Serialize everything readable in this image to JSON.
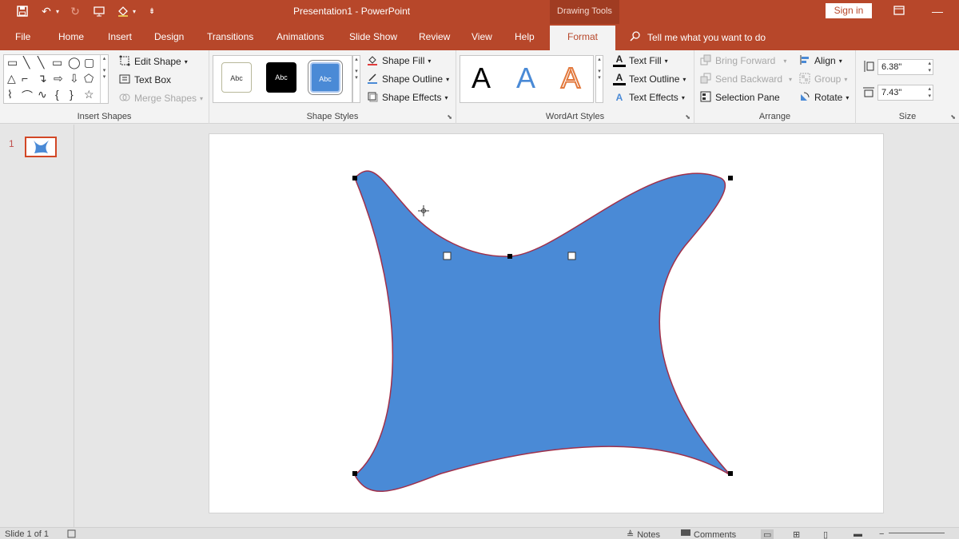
{
  "titlebar": {
    "title": "Presentation1  -  PowerPoint",
    "context_tab": "Drawing Tools",
    "signin": "Sign in",
    "qat": [
      "save-icon",
      "undo-icon",
      "redo-icon",
      "present-icon",
      "paint-icon",
      "customize-icon"
    ]
  },
  "tabs": [
    {
      "label": "File"
    },
    {
      "label": "Home"
    },
    {
      "label": "Insert"
    },
    {
      "label": "Design"
    },
    {
      "label": "Transitions"
    },
    {
      "label": "Animations"
    },
    {
      "label": "Slide Show"
    },
    {
      "label": "Review"
    },
    {
      "label": "View"
    },
    {
      "label": "Help"
    },
    {
      "label": "Format"
    }
  ],
  "tellme": "Tell me what you want to do",
  "ribbon": {
    "insert_shapes": {
      "label": "Insert Shapes",
      "edit_shape": "Edit Shape",
      "text_box": "Text Box",
      "merge_shapes": "Merge Shapes"
    },
    "shape_styles": {
      "label": "Shape Styles",
      "swatch_text": "Abc",
      "shape_fill": "Shape Fill",
      "shape_outline": "Shape Outline",
      "shape_effects": "Shape Effects"
    },
    "wordart": {
      "label": "WordArt Styles",
      "letter": "A",
      "text_fill": "Text Fill",
      "text_outline": "Text Outline",
      "text_effects": "Text Effects"
    },
    "arrange": {
      "label": "Arrange",
      "bring_forward": "Bring Forward",
      "send_backward": "Send Backward",
      "selection_pane": "Selection Pane",
      "align": "Align",
      "group": "Group",
      "rotate": "Rotate"
    },
    "size": {
      "label": "Size",
      "height": "6.38\"",
      "width": "7.43\""
    }
  },
  "thumbs": {
    "number": "1"
  },
  "colors": {
    "accent": "#b7472a",
    "shape_fill": "#4a8ad6",
    "shape_outline": "#a0304a"
  },
  "status": {
    "slide": "Slide 1 of 1",
    "notes": "Notes",
    "comments": "Comments"
  }
}
